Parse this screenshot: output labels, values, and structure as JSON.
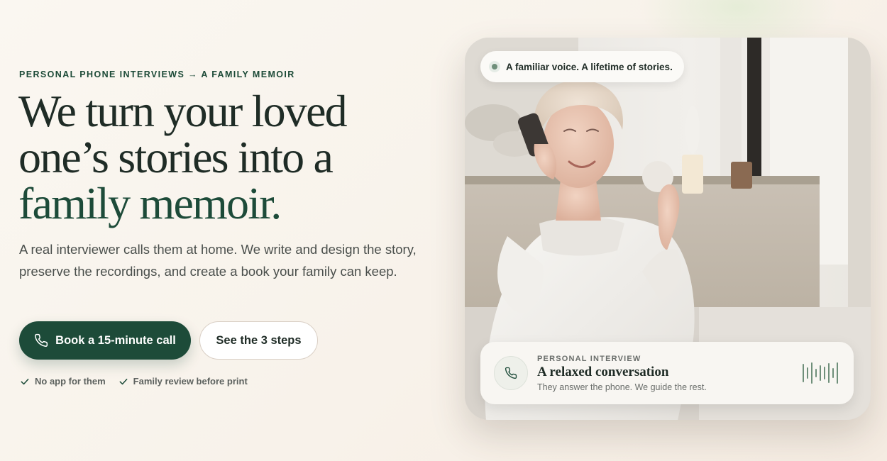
{
  "hero": {
    "eyebrow": "PERSONAL PHONE INTERVIEWS → A FAMILY MEMOIR",
    "headline_line1": "We turn your loved",
    "headline_line2": "one’s stories into a",
    "headline_accent": "family memoir.",
    "subtitle": "A real interviewer calls them at home. We write and design the story, preserve the recordings, and create a book your family can keep.",
    "primary_cta": "Book a 15-minute call",
    "secondary_cta": "See the 3 steps",
    "checks": [
      "No app for them",
      "Family review before print"
    ]
  },
  "card": {
    "badge": "A familiar voice. A lifetime of stories.",
    "info": {
      "eyebrow": "PERSONAL INTERVIEW",
      "title": "A relaxed conversation",
      "description": "They answer the phone. We guide the rest."
    }
  },
  "colors": {
    "brand_green": "#1d4b39",
    "text_dark": "#1f2c26",
    "muted": "#4a4f4c",
    "wave": "#6f8f7a"
  },
  "icons": [
    "phone-icon",
    "check-icon",
    "audio-wave-icon"
  ]
}
